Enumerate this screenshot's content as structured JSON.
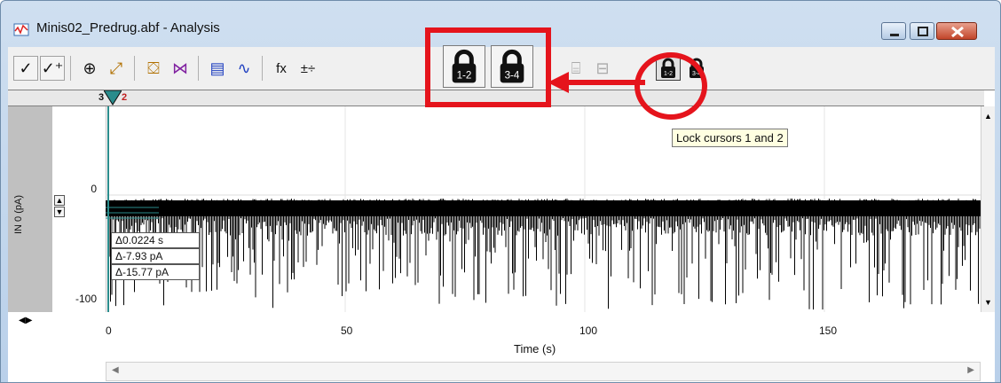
{
  "window": {
    "title": "Minis02_Predrug.abf - Analysis"
  },
  "toolbar": {
    "items": [
      {
        "name": "accept-button",
        "glyph": "✓"
      },
      {
        "name": "accept-all-button",
        "glyph": "✓⁺"
      },
      {
        "name": "zoom-in-button",
        "glyph": "⊕"
      },
      {
        "name": "fit-button",
        "glyph": "⤢"
      },
      {
        "name": "template-button",
        "glyph": "⛋"
      },
      {
        "name": "event-detect-button",
        "glyph": "⋈"
      },
      {
        "name": "histogram-button",
        "glyph": "▤"
      },
      {
        "name": "average-button",
        "glyph": "∿"
      },
      {
        "name": "function-button",
        "glyph": "fx"
      },
      {
        "name": "arithmetic-button",
        "glyph": "±÷"
      }
    ],
    "lock_cursors_12_label": "1-2",
    "lock_cursors_34_label": "3-4"
  },
  "cursor_bar": {
    "markers": [
      "3",
      "2"
    ]
  },
  "plot": {
    "y_axis_label": "IN 0 (pA)",
    "y_ticks": [
      "0",
      "-100"
    ],
    "x_ticks": [
      "0",
      "50",
      "100",
      "150"
    ],
    "x_axis_label": "Time (s)",
    "trace_color": "#000000",
    "cursor_color": "#2a8c8c"
  },
  "deltas": [
    "Δ0.0224 s",
    "Δ-7.93 pA",
    "Δ-15.77 pA"
  ],
  "tooltip": "Lock cursors 1 and 2",
  "callouts": {
    "color": "#e5141c"
  }
}
